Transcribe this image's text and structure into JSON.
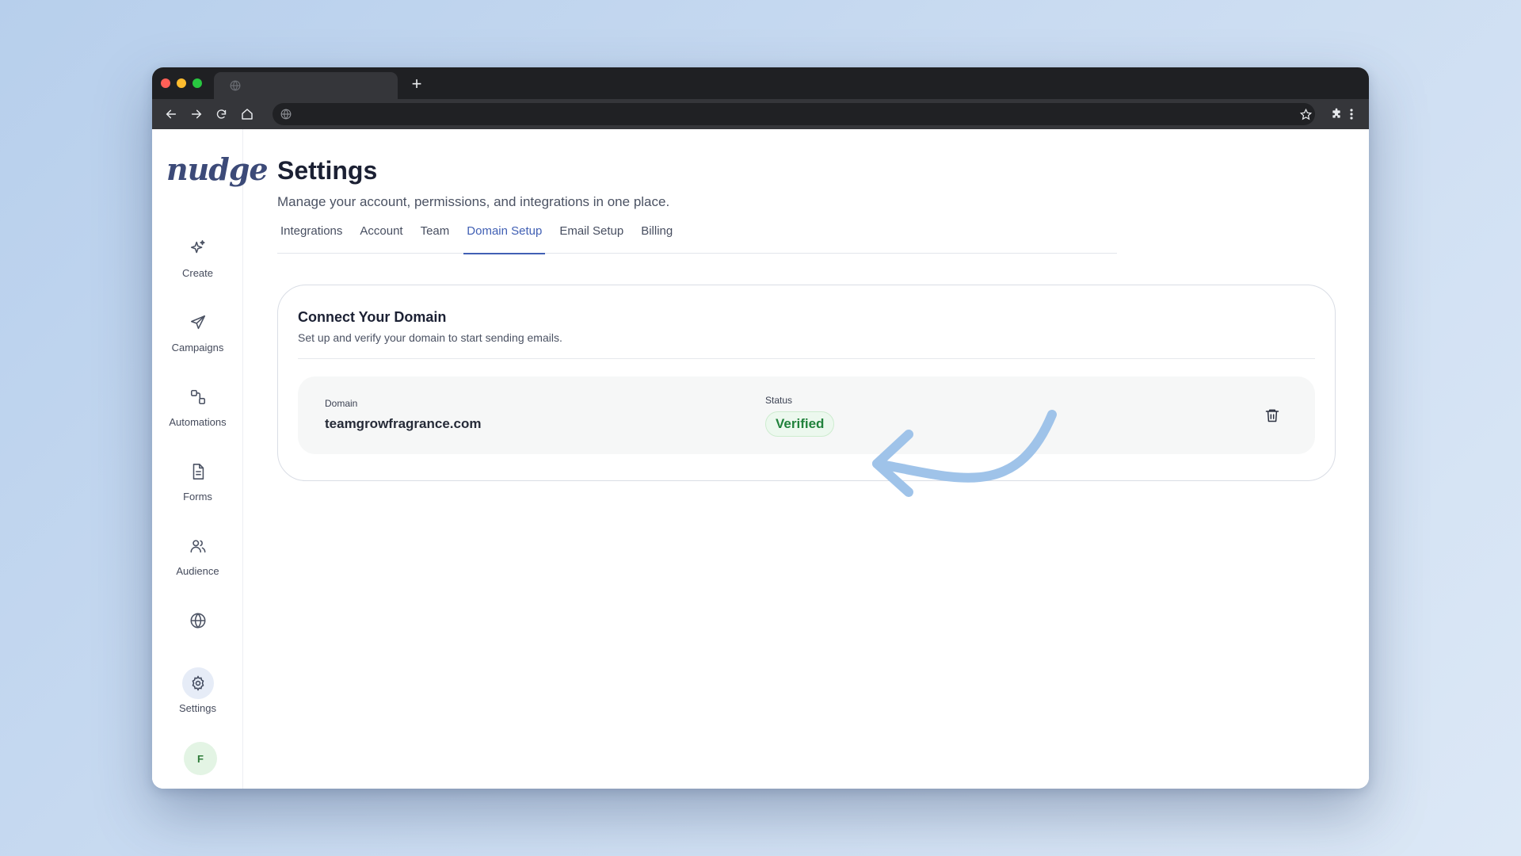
{
  "browser": {
    "new_tab": "+"
  },
  "app": {
    "logo": "nudge",
    "nav": [
      {
        "label": "Create",
        "icon": "sparkle-icon"
      },
      {
        "label": "Campaigns",
        "icon": "send-icon"
      },
      {
        "label": "Automations",
        "icon": "workflow-icon"
      },
      {
        "label": "Forms",
        "icon": "document-icon"
      },
      {
        "label": "Audience",
        "icon": "users-icon"
      },
      {
        "label": "",
        "icon": "globe-icon"
      },
      {
        "label": "Settings",
        "icon": "gear-icon",
        "active": true
      }
    ],
    "avatar_initial": "F"
  },
  "page": {
    "title": "Settings",
    "subtitle": "Manage your account, permissions, and integrations in one place.",
    "tabs": [
      "Integrations",
      "Account",
      "Team",
      "Domain Setup",
      "Email Setup",
      "Billing"
    ],
    "active_tab": "Domain Setup"
  },
  "card": {
    "title": "Connect Your Domain",
    "subtitle": "Set up and verify your domain to start sending emails.",
    "domain_label": "Domain",
    "domain_value": "teamgrowfragrance.com",
    "status_label": "Status",
    "status_value": "Verified"
  },
  "colors": {
    "accent": "#4160b4",
    "verified": "#21823c",
    "annotation_arrow": "#9fc3e9"
  }
}
